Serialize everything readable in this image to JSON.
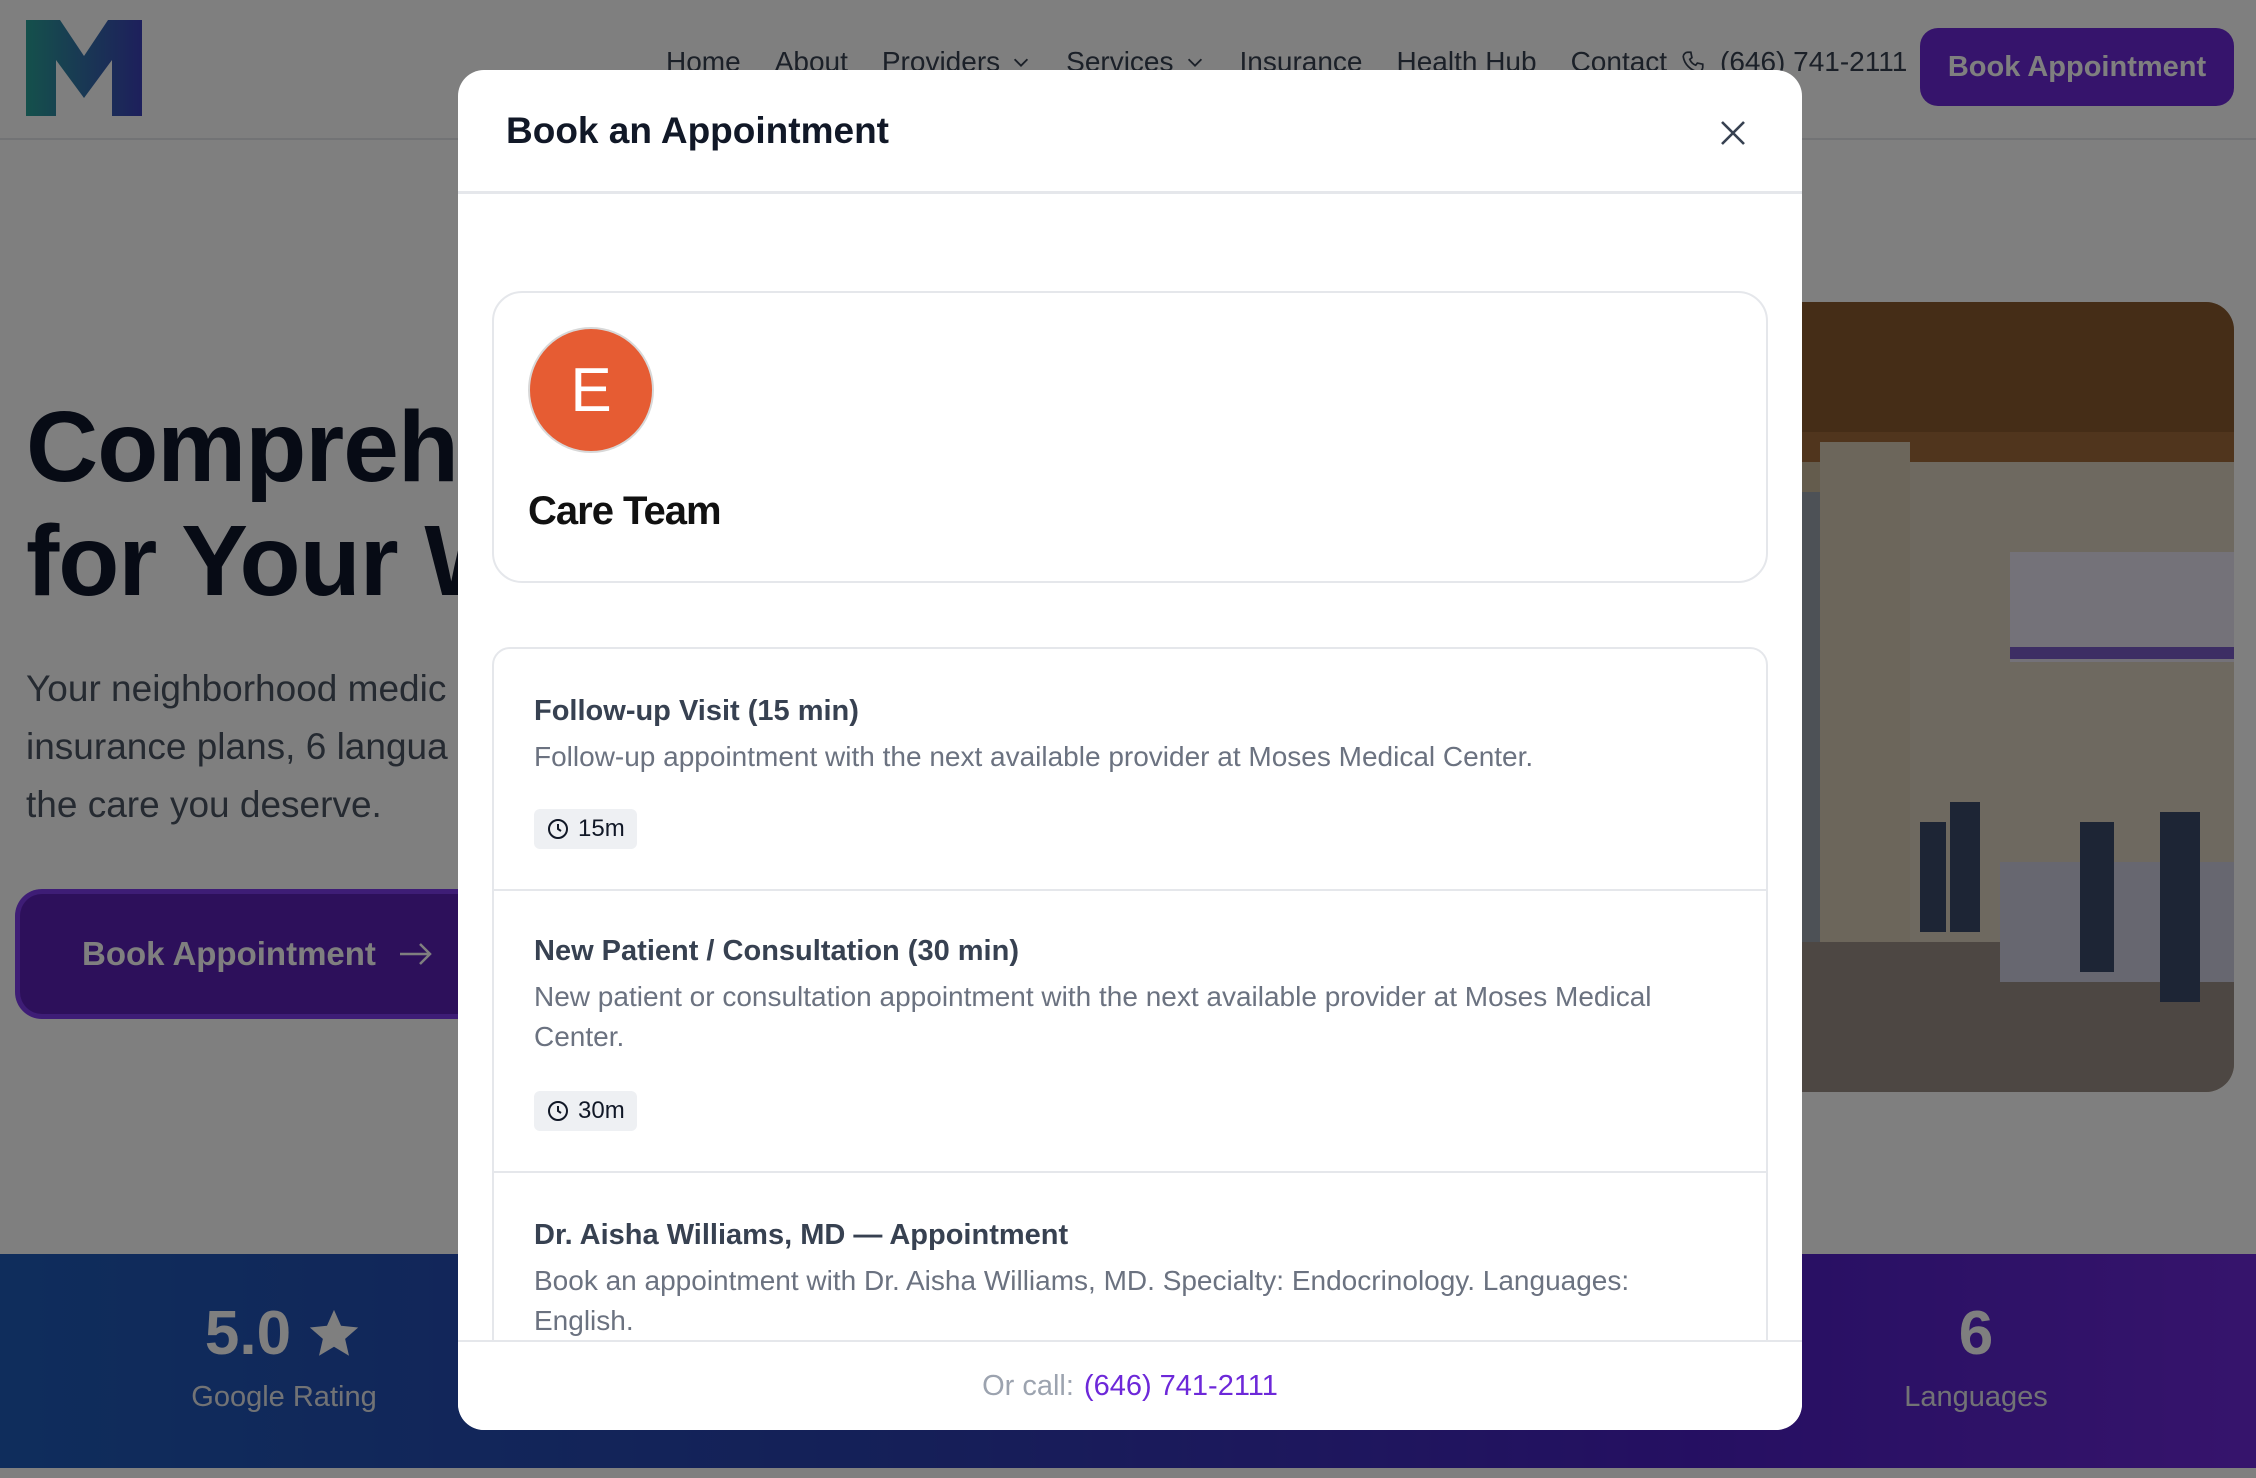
{
  "nav": {
    "links": [
      "Home",
      "About",
      "Providers",
      "Services",
      "Insurance",
      "Health Hub",
      "Contact"
    ],
    "phone": "(646) 741-2111",
    "cta": "Book Appointment"
  },
  "hero": {
    "title_line1": "Comprehe",
    "title_line2": "for Your W",
    "sub_line1": "Your neighborhood medic",
    "sub_line2": "insurance plans, 6 langua",
    "sub_line3": "the care you deserve.",
    "cta": "Book Appointment"
  },
  "stats": [
    {
      "value": "5.0",
      "label": "Google Rating"
    },
    {
      "value": "6",
      "label": "Languages"
    }
  ],
  "modal": {
    "title": "Book an Appointment",
    "team": {
      "initial": "E",
      "name": "Care Team",
      "avatar_color": "#e65c33"
    },
    "services": [
      {
        "title": "Follow-up Visit (15 min)",
        "description": "Follow-up appointment with the next available provider at Moses Medical Center.",
        "duration": "15m"
      },
      {
        "title": "New Patient / Consultation (30 min)",
        "description": "New patient or consultation appointment with the next available provider at Moses Medical Center.",
        "duration": "30m"
      },
      {
        "title": "Dr. Aisha Williams, MD — Appointment",
        "description": "Book an appointment with Dr. Aisha Williams, MD. Specialty: Endocrinology. Languages: English.",
        "duration": ""
      }
    ],
    "footer_label": "Or call:",
    "footer_phone": "(646) 741-2111"
  },
  "colors": {
    "accent": "#6d28d9",
    "overlay": "rgba(0,0,0,0.5)"
  }
}
